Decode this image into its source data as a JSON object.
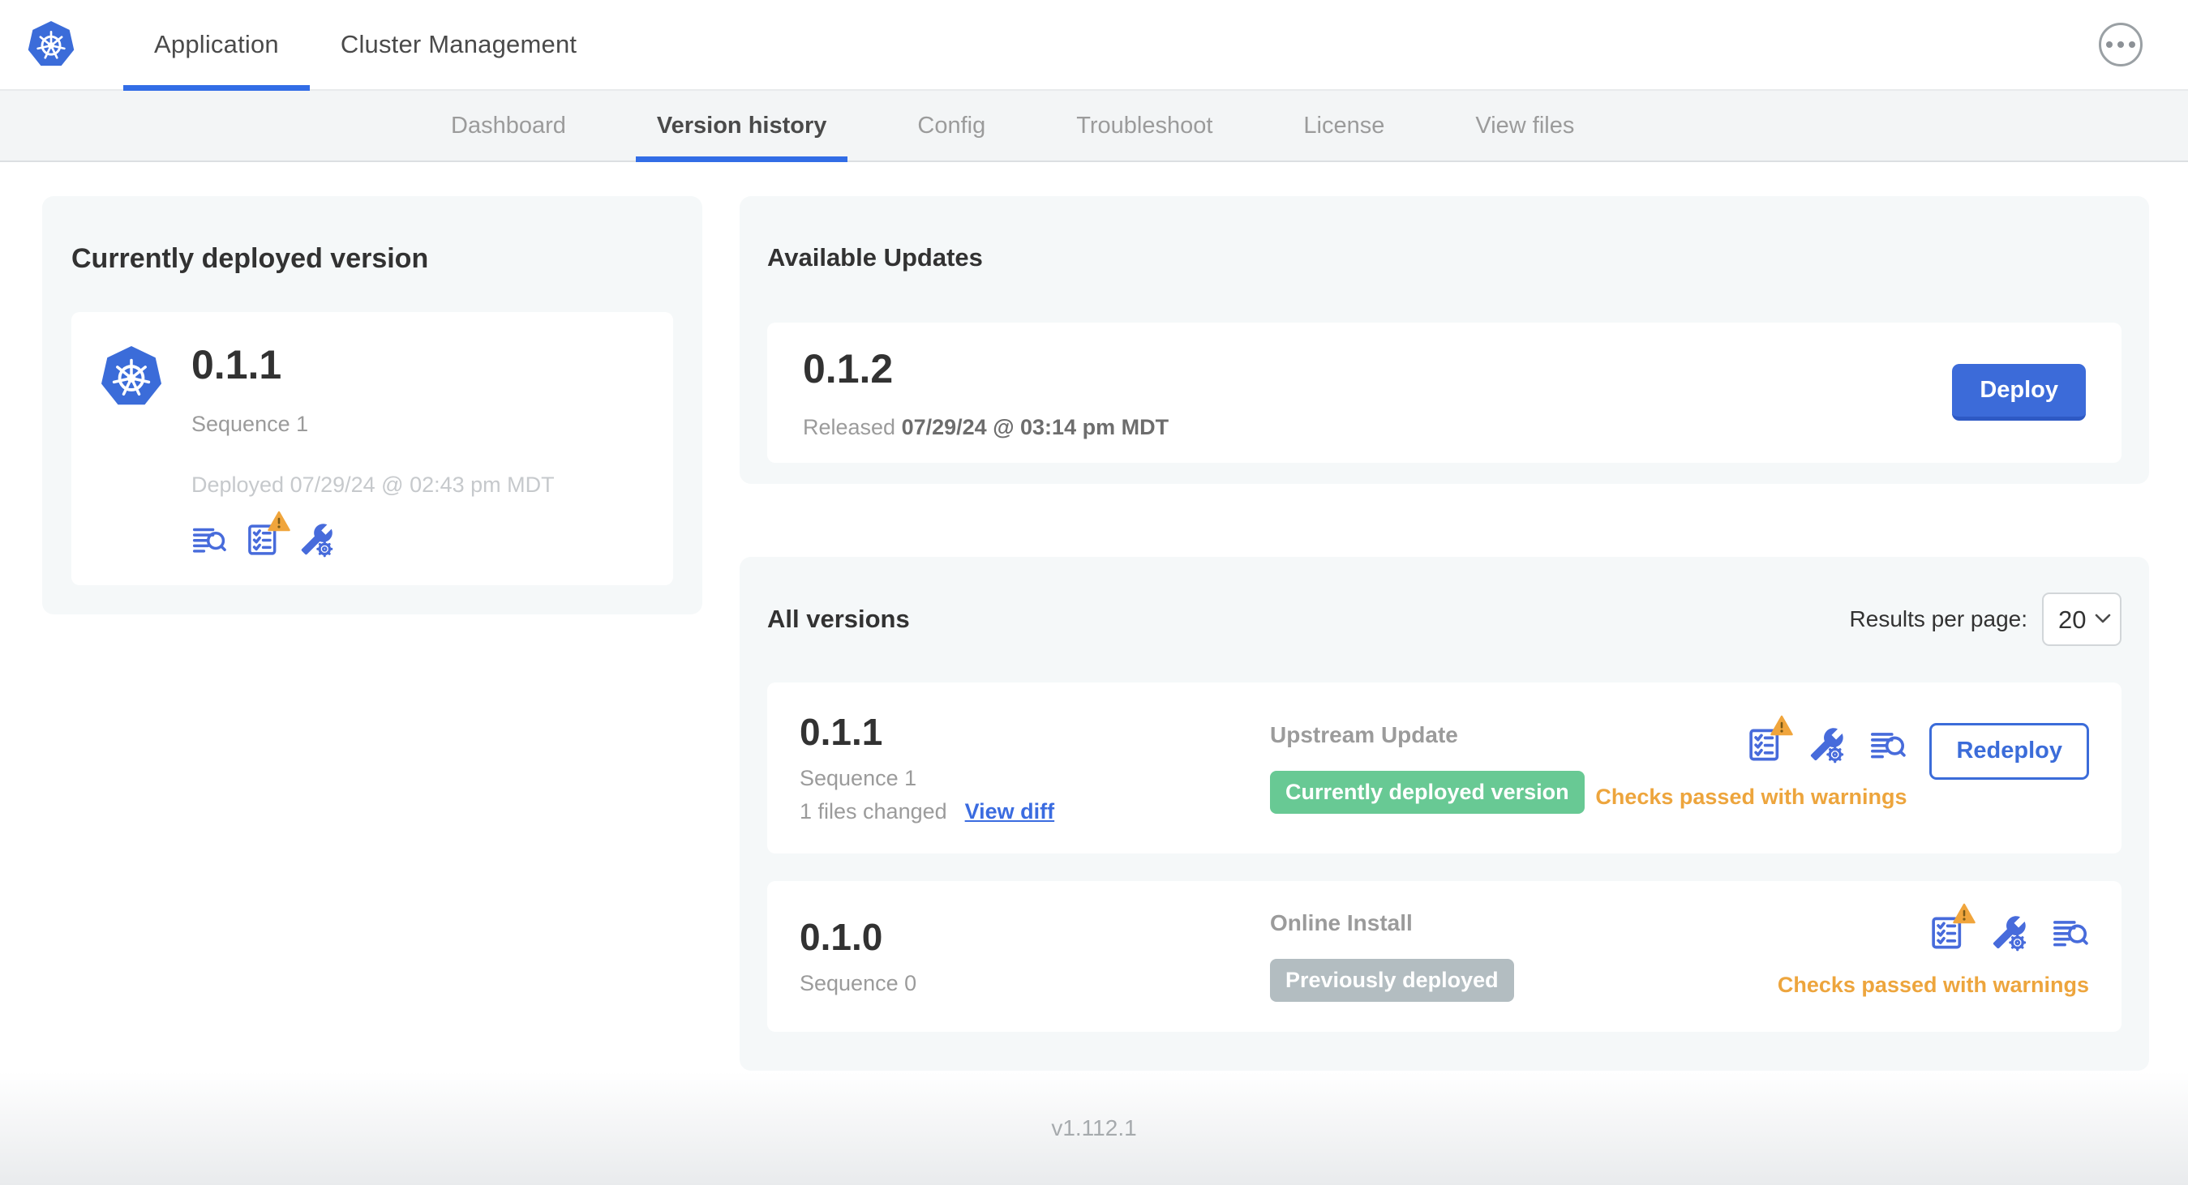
{
  "header": {
    "tabs": [
      {
        "label": "Application"
      },
      {
        "label": "Cluster Management"
      }
    ],
    "active_tab": "Application",
    "menu_icon": "ellipsis-circle-icon"
  },
  "subnav": {
    "items": [
      "Dashboard",
      "Version history",
      "Config",
      "Troubleshoot",
      "License",
      "View files"
    ],
    "active": "Version history"
  },
  "currently_deployed": {
    "title": "Currently deployed version",
    "logo_icon": "kubernetes-logo",
    "version": "0.1.1",
    "sequence": "Sequence 1",
    "deployed_at": "Deployed 07/29/24 @ 02:43 pm MDT",
    "icons": [
      "view-logs-icon",
      "preflight-checks-warning-icon",
      "edit-config-icon"
    ]
  },
  "available_updates": {
    "title": "Available Updates",
    "version": "0.1.2",
    "released_prefix": "Released",
    "released_date": "07/29/24 @ 03:14 pm MDT",
    "deploy_label": "Deploy"
  },
  "all_versions": {
    "title": "All versions",
    "results_per_page_label": "Results per page:",
    "results_per_page_value": "20",
    "rows": [
      {
        "version": "0.1.1",
        "sequence": "Sequence 1",
        "files_changed": "1 files changed",
        "view_diff_label": "View diff",
        "source": "Upstream Update",
        "badge": "Currently deployed version",
        "badge_color": "#68c994",
        "icons": [
          "preflight-checks-warning-icon",
          "edit-config-icon",
          "view-logs-icon"
        ],
        "status": "Checks passed with warnings",
        "action_label": "Redeploy"
      },
      {
        "version": "0.1.0",
        "sequence": "Sequence 0",
        "source": "Online Install",
        "badge": "Previously deployed",
        "badge_color": "#b3bdc1",
        "icons": [
          "preflight-checks-warning-icon",
          "edit-config-icon",
          "view-logs-icon"
        ],
        "status": "Checks passed with warnings"
      }
    ]
  },
  "footer": {
    "app_version": "v1.112.1"
  },
  "colors": {
    "accent_blue": "#326de6",
    "button_blue": "#3c6bd9",
    "icon_blue": "#476bdb",
    "link_blue": "#3b6ce0",
    "badge_green": "#68c994",
    "badge_gray": "#b3bdc1",
    "warning_orange": "#eda53d",
    "panel_gray": "#f5f8f9"
  }
}
